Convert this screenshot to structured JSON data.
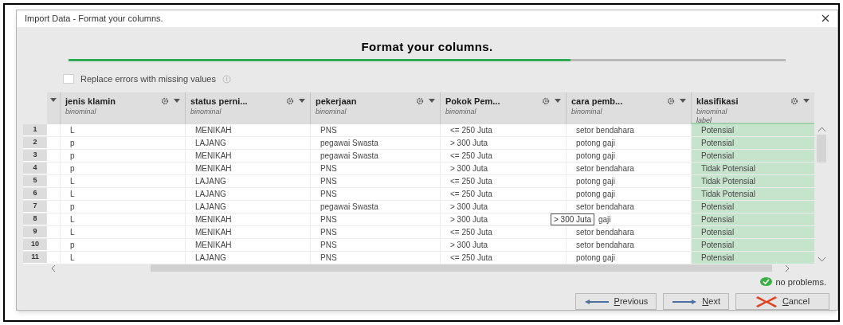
{
  "window": {
    "title": "Import Data - Format your columns."
  },
  "heading": "Format your columns.",
  "progress": {
    "level": 0.7
  },
  "replace_errors": {
    "label": "Replace errors with missing values",
    "checked": false
  },
  "table": {
    "columns": [
      {
        "name": "jenis klamin",
        "type": "binominal",
        "label_role": false
      },
      {
        "name": "status perni...",
        "type": "binominal",
        "label_role": false
      },
      {
        "name": "pekerjaan",
        "type": "binominal",
        "label_role": false
      },
      {
        "name": "Pokok Pem...",
        "type": "binominal",
        "label_role": false
      },
      {
        "name": "cara pemb...",
        "type": "binominal",
        "label_role": false
      },
      {
        "name": "klasifikasi",
        "type": "binominal",
        "role": "label",
        "label_role": true
      }
    ],
    "rows": [
      {
        "index": "1",
        "cells": [
          "L",
          "MENIKAH",
          "PNS",
          "<= 250 Juta",
          "setor bendahara",
          "Potensial"
        ]
      },
      {
        "index": "2",
        "cells": [
          "p",
          "LAJANG",
          "pegawai Swasta",
          "> 300 Juta",
          "potong gaji",
          "Potensial"
        ]
      },
      {
        "index": "3",
        "cells": [
          "p",
          "MENIKAH",
          "pegawai Swasta",
          "<= 250 Juta",
          "potong gaji",
          "Potensial"
        ]
      },
      {
        "index": "4",
        "cells": [
          "p",
          "MENIKAH",
          "PNS",
          "> 300 Juta",
          "setor bendahara",
          "Tidak Potensial"
        ]
      },
      {
        "index": "5",
        "cells": [
          "L",
          "LAJANG",
          "PNS",
          "<= 250 Juta",
          "potong gaji",
          "Tidak Potensial"
        ]
      },
      {
        "index": "6",
        "cells": [
          "L",
          "LAJANG",
          "PNS",
          "<= 250 Juta",
          "potong gaji",
          "Tidak Potensial"
        ]
      },
      {
        "index": "7",
        "cells": [
          "p",
          "LAJANG",
          "pegawai Swasta",
          "> 300 Juta",
          "setor bendahara",
          "Potensial"
        ]
      },
      {
        "index": "8",
        "cells": [
          "L",
          "MENIKAH",
          "PNS",
          "> 300 Juta",
          {
            "text": "gaji",
            "tooltip": "> 300 Juta"
          },
          "Potensial"
        ]
      },
      {
        "index": "9",
        "cells": [
          "L",
          "MENIKAH",
          "PNS",
          "<= 250 Juta",
          "setor bendahara",
          "Potensial"
        ]
      },
      {
        "index": "10",
        "cells": [
          "p",
          "MENIKAH",
          "PNS",
          "> 300 Juta",
          "setor bendahara",
          "Potensial"
        ]
      },
      {
        "index": "11",
        "cells": [
          "L",
          "LAJANG",
          "PNS",
          "<= 250 Juta",
          "potong gaji",
          "Potensial"
        ]
      }
    ]
  },
  "status": "no problems.",
  "buttons": [
    {
      "kind": "previous",
      "label": "Previous"
    },
    {
      "kind": "next",
      "label": "Next"
    },
    {
      "kind": "cancel",
      "label": "Cancel"
    }
  ]
}
